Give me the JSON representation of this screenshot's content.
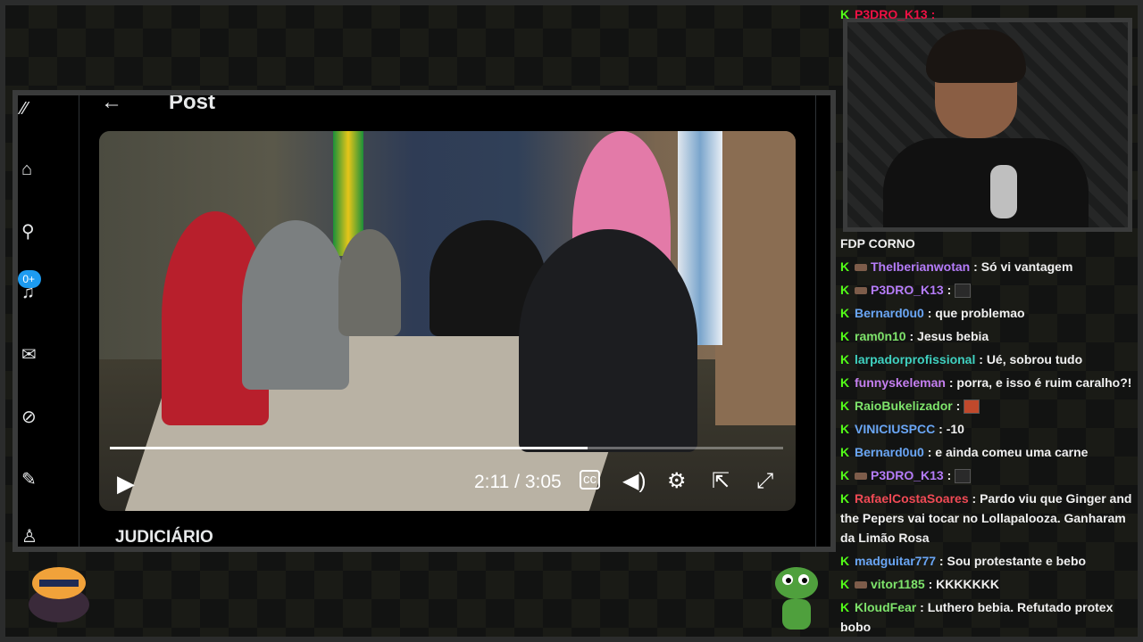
{
  "post": {
    "back_label": "←",
    "title": "Post",
    "caption": "JUDICIÁRIO",
    "nav_badge": "0+"
  },
  "video": {
    "time": "2:11 / 3:05",
    "progress": 0.71
  },
  "chat": {
    "top_partial": "P3DRO_K13 :",
    "overflow_text": "FDP CORNO",
    "messages": [
      {
        "user": "TheIberianwotan",
        "color": "#b57cf9",
        "sub": true,
        "text": "Só vi vantagem"
      },
      {
        "user": "P3DRO_K13",
        "color": "#b57cf9",
        "sub": true,
        "text": "",
        "emote": true
      },
      {
        "user": "Bernard0u0",
        "color": "#6aa6f5",
        "sub": false,
        "text": "que problemao"
      },
      {
        "user": "ram0n10",
        "color": "#7ee36b",
        "sub": false,
        "text": "Jesus bebia"
      },
      {
        "user": "larpadorprofissional",
        "color": "#3fd1c0",
        "sub": false,
        "text": "Ué, sobrou tudo"
      },
      {
        "user": "funnyskeleman",
        "color": "#c57ff0",
        "sub": false,
        "text": "porra, e isso é ruim caralho?!"
      },
      {
        "user": "RaioBukelizador",
        "color": "#7ee36b",
        "sub": false,
        "text": "",
        "emote": true,
        "emote_red": true
      },
      {
        "user": "VINICIUSPCC",
        "color": "#6aa6f5",
        "sub": false,
        "text": "-10"
      },
      {
        "user": "Bernard0u0",
        "color": "#6aa6f5",
        "sub": false,
        "text": "e ainda comeu uma carne"
      },
      {
        "user": "P3DRO_K13",
        "color": "#b57cf9",
        "sub": true,
        "text": "",
        "emote": true
      },
      {
        "user": "RafaelCostaSoares",
        "color": "#f04a55",
        "sub": false,
        "text": "Pardo viu que Ginger and the Pepers vai tocar no Lollapalooza. Ganharam da Limão Rosa"
      },
      {
        "user": "madguitar777",
        "color": "#6aa6f5",
        "sub": false,
        "text": "Sou protestante e bebo"
      },
      {
        "user": "vitor1185",
        "color": "#7ee36b",
        "sub": true,
        "text": "KKKKKKK"
      },
      {
        "user": "KloudFear",
        "color": "#7ee36b",
        "sub": false,
        "text": "Luthero bebia. Refutado protex bobo"
      }
    ]
  }
}
